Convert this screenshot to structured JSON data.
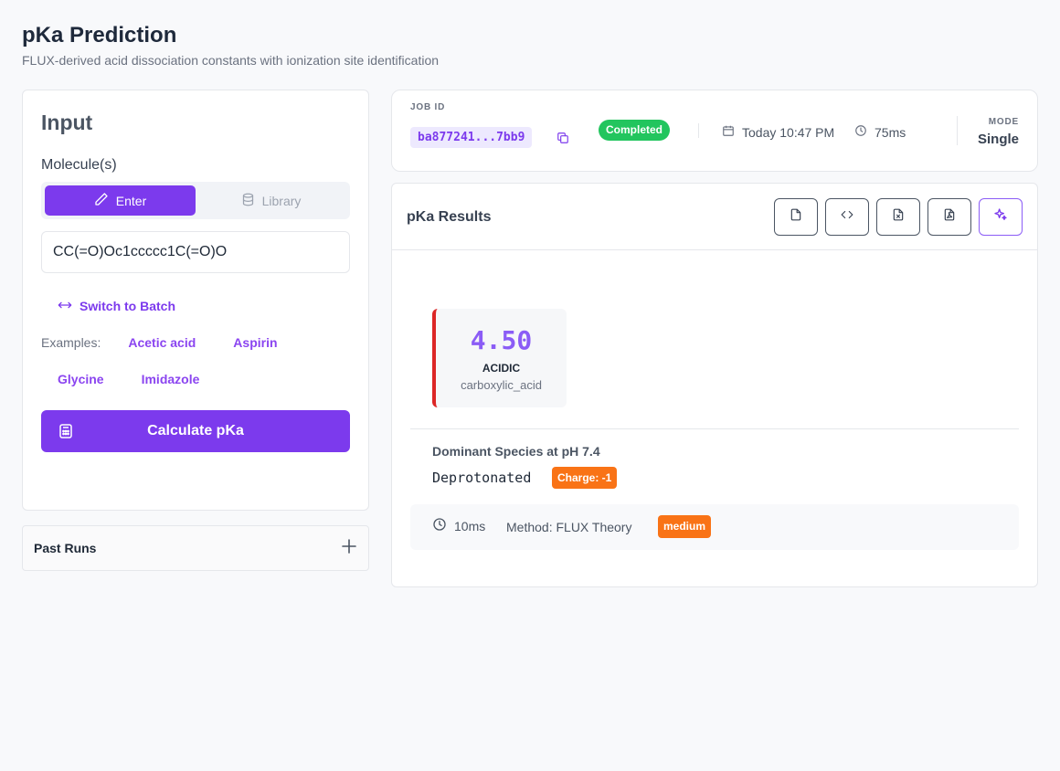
{
  "header": {
    "title": "pKa Prediction",
    "subtitle": "FLUX-derived acid dissociation constants with ionization site identification"
  },
  "input_panel": {
    "title": "Input",
    "molecule_label": "Molecule(s)",
    "tabs": [
      {
        "label": "Enter",
        "active": true,
        "icon": "pencil-icon"
      },
      {
        "label": "Library",
        "active": false,
        "icon": "database-icon"
      }
    ],
    "molecule_value": "CC(=O)Oc1ccccc1C(=O)O",
    "switch_label": "Switch to Batch",
    "examples_label": "Examples:",
    "examples": [
      "Acetic acid",
      "Aspirin",
      "Glycine",
      "Imidazole"
    ],
    "calculate_label": "Calculate pKa"
  },
  "past_runs": {
    "label": "Past Runs"
  },
  "job": {
    "id_label": "JOB ID",
    "id_value": "ba877241...7bb9",
    "status": "Completed",
    "date": "Today 10:47 PM",
    "duration": "75ms",
    "mode_label": "MODE",
    "mode_value": "Single"
  },
  "results": {
    "title": "pKa Results",
    "toolbar_icons": [
      "file-icon",
      "code-icon",
      "excel-icon",
      "pdf-icon",
      "sparkle-icon"
    ],
    "sites": [
      {
        "pka": "4.50",
        "type": "ACIDIC",
        "group": "carboxylic_acid"
      }
    ],
    "dominant_title": "Dominant Species at pH 7.4",
    "dominant_value": "Deprotonated",
    "charge": "Charge: -1",
    "time": "10ms",
    "method": "Method: FLUX Theory",
    "confidence": "medium"
  },
  "colors": {
    "accent": "#7c3aed",
    "success": "#22c55e",
    "warning": "#f97316",
    "acidic_border": "#dc2626"
  }
}
